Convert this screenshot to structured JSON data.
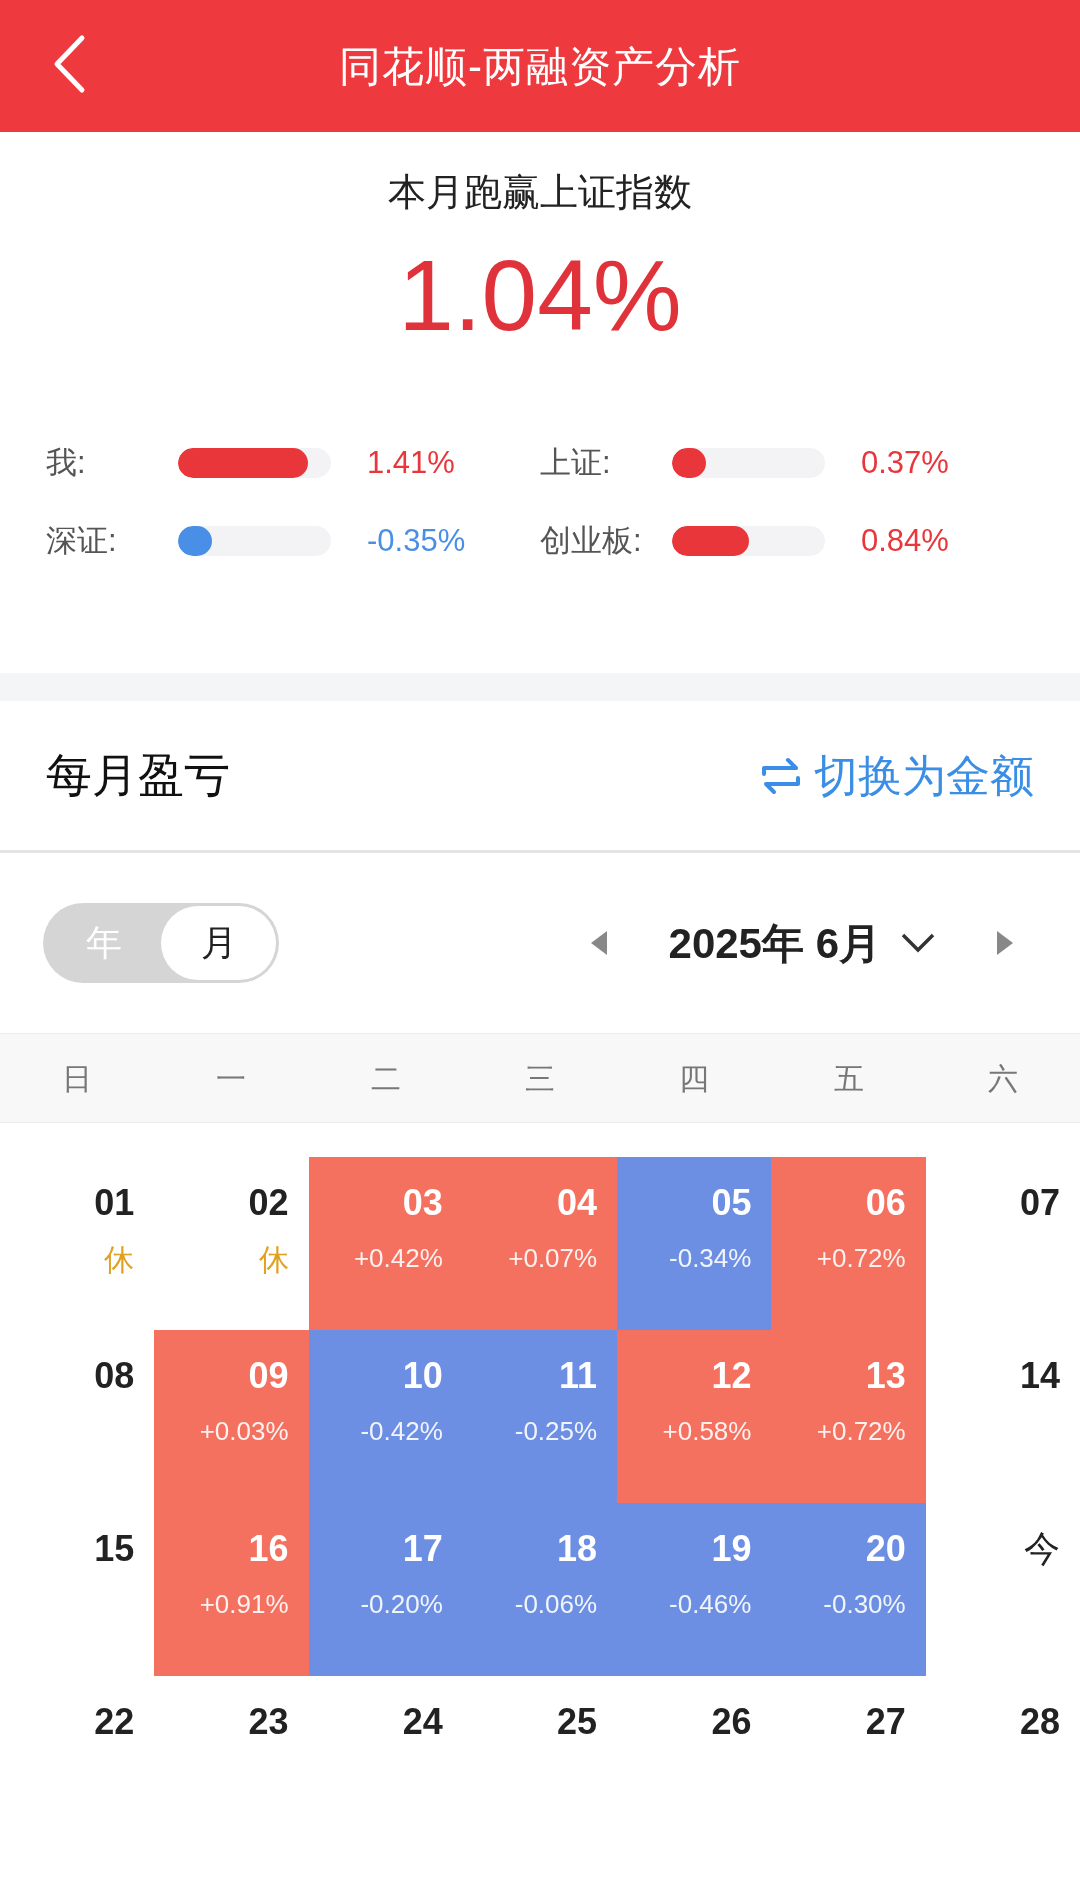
{
  "header": {
    "title": "同花顺-两融资产分析"
  },
  "summary": {
    "caption": "本月跑赢上证指数",
    "value": "1.04%"
  },
  "comparisons": [
    {
      "label": "我:",
      "level": 0.85,
      "color": "#e8363b",
      "value": "1.41%"
    },
    {
      "label": "上证:",
      "level": 0.22,
      "color": "#e8363b",
      "value": "0.37%"
    },
    {
      "label": "深证:",
      "level": 0.22,
      "color": "#4a8fe7",
      "value": "-0.35%"
    },
    {
      "label": "创业板:",
      "level": 0.5,
      "color": "#e8363b",
      "value": "0.84%"
    }
  ],
  "section": {
    "title": "每月盈亏",
    "switch_label": "切换为金额"
  },
  "view_toggle": [
    {
      "label": "年",
      "selected": false
    },
    {
      "label": "月",
      "selected": true
    }
  ],
  "month_picker": {
    "label": "2025年 6月"
  },
  "weekdays": [
    "日",
    "一",
    "二",
    "三",
    "四",
    "五",
    "六"
  ],
  "weeks": [
    [
      {
        "day": "01",
        "kind": "holiday",
        "note": "休"
      },
      {
        "day": "02",
        "kind": "holiday",
        "note": "休"
      },
      {
        "day": "03",
        "kind": "gain",
        "note": "+0.42%"
      },
      {
        "day": "04",
        "kind": "gain",
        "note": "+0.07%"
      },
      {
        "day": "05",
        "kind": "loss",
        "note": "-0.34%"
      },
      {
        "day": "06",
        "kind": "gain",
        "note": "+0.72%"
      },
      {
        "day": "07",
        "kind": "plain"
      }
    ],
    [
      {
        "day": "08",
        "kind": "plain"
      },
      {
        "day": "09",
        "kind": "gain",
        "note": "+0.03%"
      },
      {
        "day": "10",
        "kind": "loss",
        "note": "-0.42%"
      },
      {
        "day": "11",
        "kind": "loss",
        "note": "-0.25%"
      },
      {
        "day": "12",
        "kind": "gain",
        "note": "+0.58%"
      },
      {
        "day": "13",
        "kind": "gain",
        "note": "+0.72%"
      },
      {
        "day": "14",
        "kind": "plain"
      }
    ],
    [
      {
        "day": "15",
        "kind": "plain"
      },
      {
        "day": "16",
        "kind": "gain",
        "note": "+0.91%"
      },
      {
        "day": "17",
        "kind": "loss",
        "note": "-0.20%"
      },
      {
        "day": "18",
        "kind": "loss",
        "note": "-0.06%"
      },
      {
        "day": "19",
        "kind": "loss",
        "note": "-0.46%"
      },
      {
        "day": "20",
        "kind": "loss",
        "note": "-0.30%"
      },
      {
        "day": "今",
        "kind": "today"
      }
    ],
    [
      {
        "day": "22",
        "kind": "plain"
      },
      {
        "day": "23",
        "kind": "plain"
      },
      {
        "day": "24",
        "kind": "plain"
      },
      {
        "day": "25",
        "kind": "plain"
      },
      {
        "day": "26",
        "kind": "plain"
      },
      {
        "day": "27",
        "kind": "plain"
      },
      {
        "day": "28",
        "kind": "plain"
      }
    ]
  ]
}
